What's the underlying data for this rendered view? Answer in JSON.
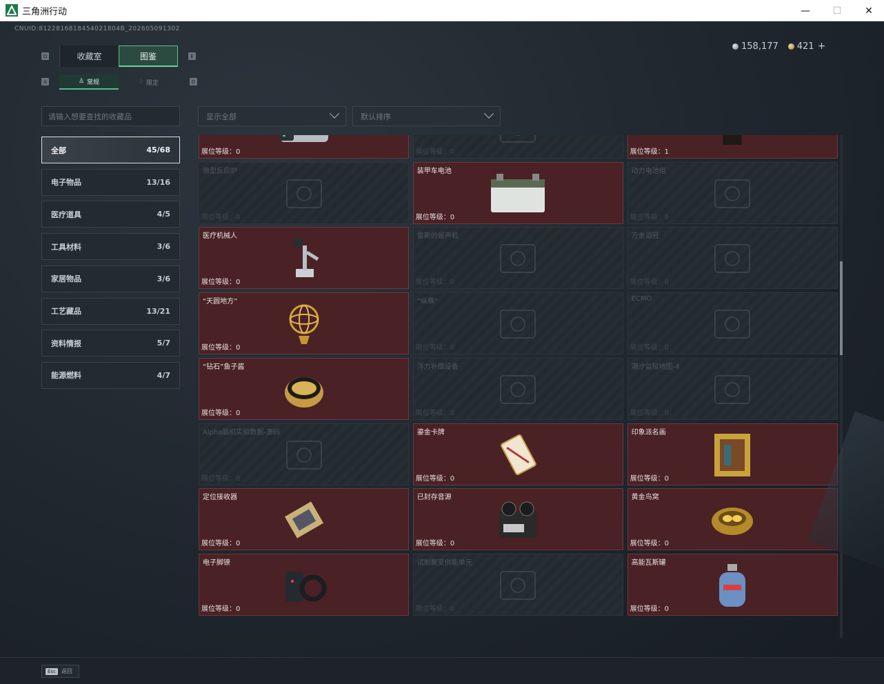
{
  "window": {
    "title": "三角洲行动"
  },
  "header": {
    "uid": "CNUID:8122816818454021804B_202605091302",
    "currency": [
      {
        "icon": "silver-coin-icon",
        "value": "158,177"
      },
      {
        "icon": "gold-coin-icon",
        "value": "421"
      }
    ],
    "plus": "+"
  },
  "tabs": {
    "main": [
      {
        "label": "收藏室",
        "active": false
      },
      {
        "label": "图鉴",
        "active": true
      }
    ],
    "sub": [
      {
        "label": "常规",
        "active": true
      },
      {
        "label": "限定",
        "active": false
      }
    ],
    "key_q": "Q",
    "key_e": "E",
    "key_a": "A",
    "key_d": "D"
  },
  "search": {
    "placeholder": "请输入想要查找的收藏品"
  },
  "filters": {
    "show": "显示全部",
    "sort": "默认排序"
  },
  "categories": [
    {
      "label": "全部",
      "count": "45/68"
    },
    {
      "label": "电子物品",
      "count": "13/16"
    },
    {
      "label": "医疗道具",
      "count": "4/5"
    },
    {
      "label": "工具材料",
      "count": "3/6"
    },
    {
      "label": "家居物品",
      "count": "3/6"
    },
    {
      "label": "工艺藏品",
      "count": "13/21"
    },
    {
      "label": "资料情报",
      "count": "5/7"
    },
    {
      "label": "能源燃料",
      "count": "4/7"
    }
  ],
  "level_label": "展位等级：",
  "items": [
    {
      "name": "",
      "level": "0",
      "owned": true,
      "icon": "server-icon"
    },
    {
      "name": "",
      "level": "0",
      "owned": false,
      "icon": "device-icon"
    },
    {
      "name": "",
      "level": "1",
      "owned": true,
      "icon": "coffee-bag-icon"
    },
    {
      "name": "微型反应炉",
      "level": "0",
      "owned": false,
      "icon": "reactor-icon"
    },
    {
      "name": "装甲车电池",
      "level": "0",
      "owned": true,
      "icon": "battery-icon"
    },
    {
      "name": "动力电池组",
      "level": "0",
      "owned": false,
      "icon": "battery-pack-icon"
    },
    {
      "name": "医疗机械人",
      "level": "0",
      "owned": true,
      "icon": "medical-robot-icon"
    },
    {
      "name": "雷斯的留声机",
      "level": "0",
      "owned": false,
      "icon": "gramophone-icon"
    },
    {
      "name": "万金泪冠",
      "level": "0",
      "owned": false,
      "icon": "crown-icon"
    },
    {
      "name": "“天圆地方”",
      "level": "0",
      "owned": true,
      "icon": "armillary-sphere-icon"
    },
    {
      "name": "“纵横”",
      "level": "0",
      "owned": false,
      "icon": "chessboard-icon"
    },
    {
      "name": "ECMO",
      "level": "0",
      "owned": false,
      "icon": "ecmo-icon"
    },
    {
      "name": "“钻石”鱼子酱",
      "level": "0",
      "owned": true,
      "icon": "caviar-tin-icon"
    },
    {
      "name": "浮力补偿设备",
      "level": "0",
      "owned": false,
      "icon": "bcd-vest-icon"
    },
    {
      "name": "潮汐监狱地图-4",
      "level": "0",
      "owned": false,
      "icon": "map-icon"
    },
    {
      "name": "Alpha脑机实验数据-源码",
      "level": "0",
      "owned": false,
      "icon": "data-drive-icon"
    },
    {
      "name": "鎏金卡牌",
      "level": "0",
      "owned": true,
      "icon": "gold-card-icon"
    },
    {
      "name": "印象派名画",
      "level": "0",
      "owned": true,
      "icon": "painting-icon"
    },
    {
      "name": "定位接收器",
      "level": "0",
      "owned": true,
      "icon": "gps-receiver-icon"
    },
    {
      "name": "已封存音源",
      "level": "0",
      "owned": true,
      "icon": "tape-recorder-icon"
    },
    {
      "name": "黄金鸟窝",
      "level": "0",
      "owned": true,
      "icon": "golden-nest-icon"
    },
    {
      "name": "电子脚镣",
      "level": "0",
      "owned": true,
      "icon": "ankle-monitor-icon"
    },
    {
      "name": "试制聚变供能单元",
      "level": "0",
      "owned": false,
      "icon": "fusion-cell-icon"
    },
    {
      "name": "高能瓦斯罐",
      "level": "0",
      "owned": true,
      "icon": "gas-canister-icon"
    }
  ],
  "footer": {
    "esc_key": "Esc",
    "esc_label": "返回"
  }
}
